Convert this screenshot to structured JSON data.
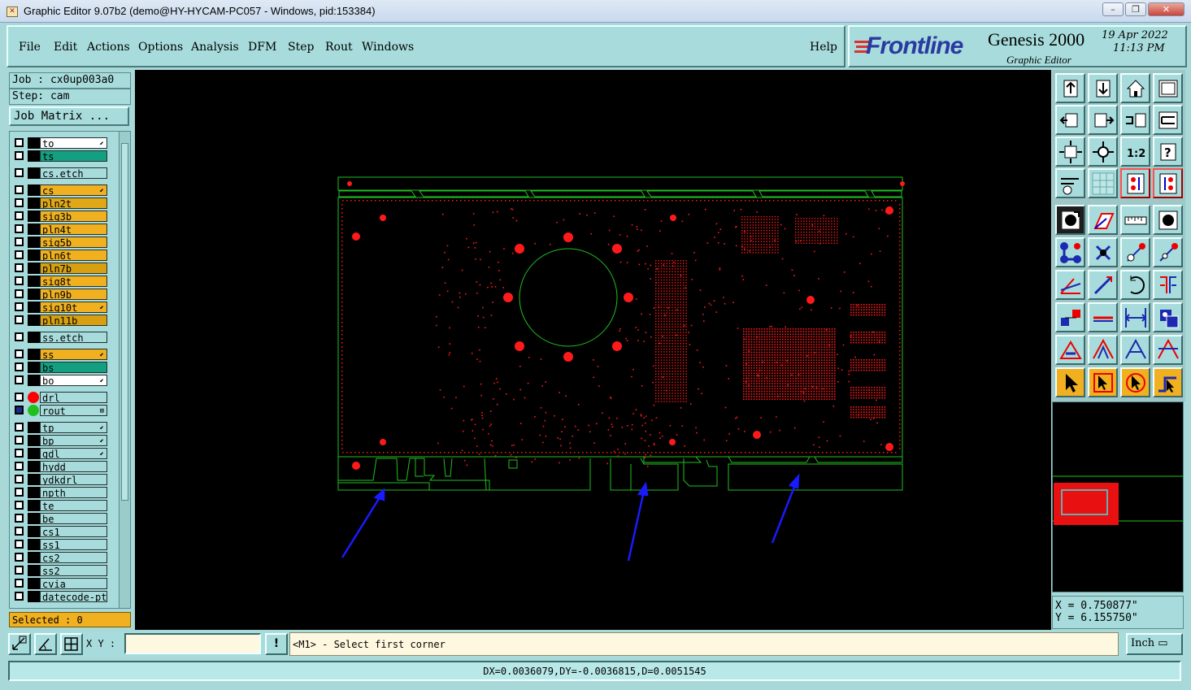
{
  "window": {
    "title": "Graphic Editor 9.07b2 (demo@HY-HYCAM-PC057 - Windows, pid:153384)",
    "minimize": "–",
    "restore": "❐",
    "close": "✕"
  },
  "menu": {
    "items": [
      "File",
      "Edit",
      "Actions",
      "Options",
      "Analysis",
      "DFM",
      "Step",
      "Rout",
      "Windows"
    ],
    "help": "Help"
  },
  "brand": {
    "logo": "Frontline",
    "product": "Genesis 2000",
    "subtitle": "Graphic Editor",
    "date": "19 Apr 2022",
    "time": "11:13 PM"
  },
  "job": {
    "job_line": "Job : cx0up003a0",
    "step_line": "Step: cam",
    "matrix_button": "Job Matrix ..."
  },
  "layers": [
    {
      "name": "to",
      "bg": "#ffffff",
      "mark": "⬋"
    },
    {
      "name": "ts",
      "bg": "#14a080",
      "mark": ""
    },
    {
      "name": "cs.etch",
      "bg": "#a8dcdc",
      "mark": ""
    },
    {
      "name": "cs",
      "bg": "#f0b020",
      "mark": "⬋"
    },
    {
      "name": "pln2t",
      "bg": "#e0a818",
      "mark": ""
    },
    {
      "name": "sig3b",
      "bg": "#f0b020",
      "mark": ""
    },
    {
      "name": "pln4t",
      "bg": "#f0b020",
      "mark": ""
    },
    {
      "name": "sig5b",
      "bg": "#f0b020",
      "mark": ""
    },
    {
      "name": "pln6t",
      "bg": "#f0b020",
      "mark": ""
    },
    {
      "name": "pln7b",
      "bg": "#d8a010",
      "mark": ""
    },
    {
      "name": "sig8t",
      "bg": "#f0b020",
      "mark": ""
    },
    {
      "name": "pln9b",
      "bg": "#f0b020",
      "mark": ""
    },
    {
      "name": "sig10t",
      "bg": "#f0b020",
      "mark": "⬋"
    },
    {
      "name": "pln11b",
      "bg": "#d8a010",
      "mark": ""
    },
    {
      "name": "ss.etch",
      "bg": "#a8dcdc",
      "mark": ""
    },
    {
      "name": "ss",
      "bg": "#f0b020",
      "mark": "⬋"
    },
    {
      "name": "bs",
      "bg": "#14a080",
      "mark": ""
    },
    {
      "name": "bo",
      "bg": "#ffffff",
      "mark": "⬋"
    },
    {
      "name": "drl",
      "bg": "#a8dcdc",
      "mark": "",
      "dot": "#ff0000"
    },
    {
      "name": "rout",
      "bg": "#a8dcdc",
      "mark": "⊞",
      "dot": "#20c020",
      "checked": true
    },
    {
      "name": "tp",
      "bg": "#a8dcdc",
      "mark": "⬋"
    },
    {
      "name": "bp",
      "bg": "#a8dcdc",
      "mark": "⬋"
    },
    {
      "name": "gdl",
      "bg": "#a8dcdc",
      "mark": "⬋"
    },
    {
      "name": "hydd",
      "bg": "#a8dcdc",
      "mark": ""
    },
    {
      "name": "ydkdrl",
      "bg": "#a8dcdc",
      "mark": ""
    },
    {
      "name": "npth",
      "bg": "#a8dcdc",
      "mark": ""
    },
    {
      "name": "te",
      "bg": "#a8dcdc",
      "mark": ""
    },
    {
      "name": "be",
      "bg": "#a8dcdc",
      "mark": ""
    },
    {
      "name": "cs1",
      "bg": "#a8dcdc",
      "mark": ""
    },
    {
      "name": "ss1",
      "bg": "#a8dcdc",
      "mark": ""
    },
    {
      "name": "cs2",
      "bg": "#a8dcdc",
      "mark": ""
    },
    {
      "name": "ss2",
      "bg": "#a8dcdc",
      "mark": ""
    },
    {
      "name": "cvia",
      "bg": "#a8dcdc",
      "mark": ""
    },
    {
      "name": "datecode-pto",
      "bg": "#a8dcdc",
      "mark": ""
    }
  ],
  "selected": "Selected : 0",
  "coords": {
    "x": "X = 0.750877\"",
    "y": "Y = 6.155750\""
  },
  "command": {
    "xy_label": "X Y :",
    "xy_value": "",
    "alert": "!",
    "prompt": "<M1> - Select first corner",
    "units": "Inch ▭"
  },
  "status": "DX=0.0036079,DY=-0.0036815,D=0.0051545",
  "colors": {
    "outline": "#20c020",
    "pads": "#ff1a1a",
    "arrows": "#1a1aff"
  }
}
